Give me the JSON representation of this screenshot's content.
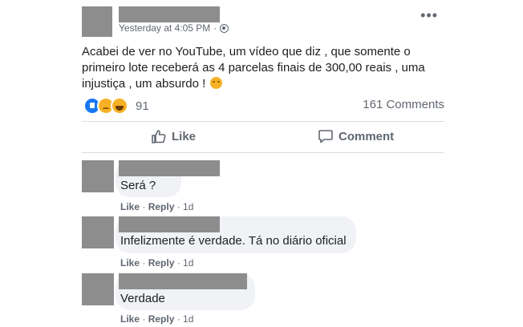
{
  "post": {
    "timestamp": "Yesterday at 4:05 PM",
    "separator": "·",
    "text": "Acabei de ver no YouTube, um vídeo que diz , que somente o primeiro lote receberá as 4 parcelas finais de 300,00 reais , uma injustiça , um absurdo !",
    "more_label": "•••",
    "reaction_count": "91",
    "comment_count": "161 Comments",
    "reaction_icons": [
      "like-reaction-icon",
      "sad-reaction-icon",
      "haha-reaction-icon"
    ]
  },
  "actions": {
    "like_label": "Like",
    "comment_label": "Comment"
  },
  "comments": [
    {
      "text": "Será ?",
      "like": "Like",
      "reply": "Reply",
      "age": "1d"
    },
    {
      "text": "Infelizmente é verdade. Tá no diário oficial",
      "like": "Like",
      "reply": "Reply",
      "age": "1d"
    },
    {
      "text": "Verdade",
      "like": "Like",
      "reply": "Reply",
      "age": "1d"
    }
  ],
  "colors": {
    "secondary_text": "#606770",
    "bubble": "#f0f2f5",
    "redaction": "#8d8d8d",
    "like_blue": "#1877f2",
    "emoji_yellow": "#f7b125"
  }
}
